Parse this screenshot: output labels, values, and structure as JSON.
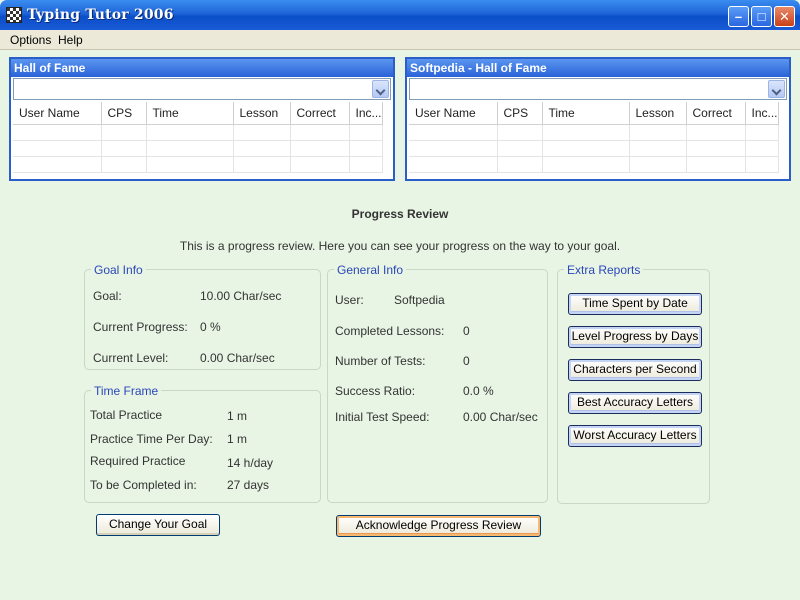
{
  "window": {
    "title": "Typing Tutor 2006"
  },
  "menu": [
    "Options",
    "Help"
  ],
  "hall_of_fame": {
    "title": "Hall of Fame",
    "columns": [
      "User Name",
      "CPS",
      "Time",
      "Lesson",
      "Correct",
      "Inc..."
    ]
  },
  "softpedia_hof": {
    "title": "Softpedia - Hall of Fame",
    "columns": [
      "User Name",
      "CPS",
      "Time",
      "Lesson",
      "Correct",
      "Inc..."
    ]
  },
  "progress": {
    "title": "Progress Review",
    "description": "This is a progress review. Here you can see your progress on the way to your goal."
  },
  "goal_info": {
    "legend": "Goal Info",
    "goal_label": "Goal:",
    "goal_value": "10.00 Char/sec",
    "progress_label": "Current Progress:",
    "progress_value": "0 %",
    "level_label": "Current Level:",
    "level_value": "0.00 Char/sec"
  },
  "time_frame": {
    "legend": "Time Frame",
    "total_label": "Total Practice",
    "total_value": "1 m",
    "perday_label": "Practice Time Per Day:",
    "perday_value": "1 m",
    "required_label": "Required Practice",
    "required_value": "14 h/day",
    "complete_label": "To be Completed in:",
    "complete_value": "27 days"
  },
  "general_info": {
    "legend": "General Info",
    "user_label": "User:",
    "user_value": "Softpedia",
    "lessons_label": "Completed Lessons:",
    "lessons_value": "0",
    "tests_label": "Number of Tests:",
    "tests_value": "0",
    "ratio_label": "Success Ratio:",
    "ratio_value": "0.0 %",
    "speed_label": "Initial Test Speed:",
    "speed_value": "0.00 Char/sec"
  },
  "extra_reports": {
    "legend": "Extra Reports",
    "buttons": [
      "Time Spent by Date",
      "Level Progress by Days",
      "Characters per Second",
      "Best Accuracy Letters",
      "Worst Accuracy Letters"
    ]
  },
  "actions": {
    "change_goal": "Change Your Goal",
    "acknowledge": "Acknowledge Progress Review"
  }
}
